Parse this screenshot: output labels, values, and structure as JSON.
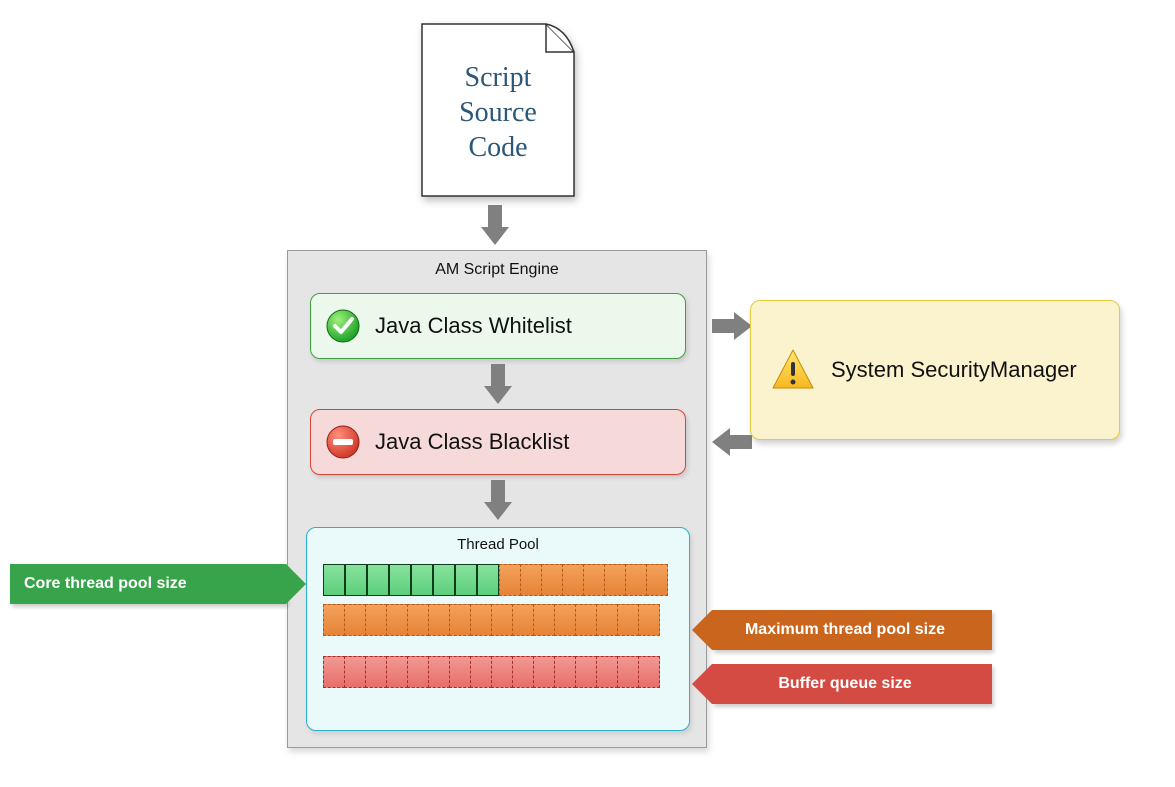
{
  "document": {
    "lines": [
      "Script",
      "Source",
      "Code"
    ]
  },
  "engine": {
    "title": "AM Script Engine",
    "whitelist": {
      "icon": "checkmark",
      "label": "Java Class Whitelist"
    },
    "blacklist": {
      "icon": "no-entry",
      "label": "Java Class Blacklist"
    },
    "thread_pool": {
      "title": "Thread Pool",
      "core_cells": 8,
      "max_cells_row1": 8,
      "max_cells_row2": 16,
      "buffer_cells": 16
    }
  },
  "security_manager": {
    "icon": "warning",
    "label": "System SecurityManager"
  },
  "tags": {
    "core": "Core thread pool size",
    "max": "Maximum thread pool size",
    "buffer": "Buffer queue size"
  }
}
